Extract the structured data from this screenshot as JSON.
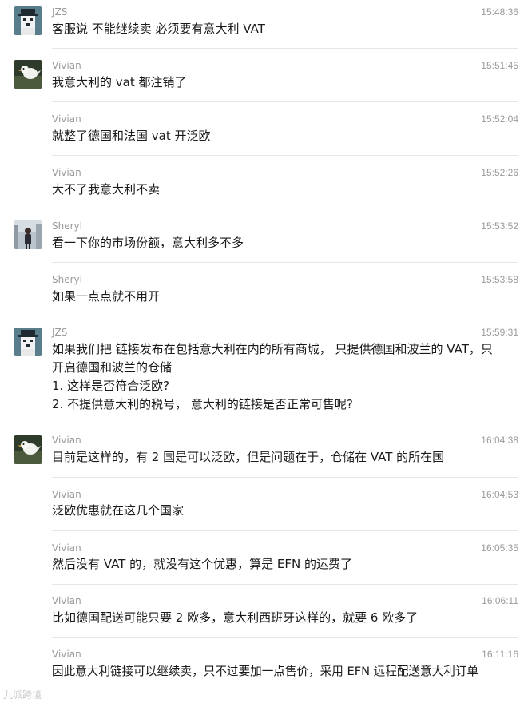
{
  "messages": [
    {
      "sender": "JZS",
      "time": "15:48:36",
      "avatar": "jzs-pixel-avatar",
      "lines": [
        "客服说 不能继续卖  必须要有意大利 VAT"
      ]
    },
    {
      "sender": "Vivian",
      "time": "15:51:45",
      "avatar": "vivian-bird-avatar",
      "lines": [
        "我意大利的 vat 都注销了"
      ]
    },
    {
      "sender": "Vivian",
      "time": "15:52:04",
      "avatar": "",
      "lines": [
        "就整了德国和法国 vat 开泛欧"
      ]
    },
    {
      "sender": "Vivian",
      "time": "15:52:26",
      "avatar": "",
      "lines": [
        "大不了我意大利不卖"
      ]
    },
    {
      "sender": "Sheryl",
      "time": "15:53:52",
      "avatar": "sheryl-photo-avatar",
      "lines": [
        "看一下你的市场份额，意大利多不多"
      ]
    },
    {
      "sender": "Sheryl",
      "time": "15:53:58",
      "avatar": "",
      "lines": [
        "如果一点点就不用开"
      ]
    },
    {
      "sender": "JZS",
      "time": "15:59:31",
      "avatar": "jzs-pixel-avatar",
      "lines": [
        "如果我们把 链接发布在包括意大利在内的所有商城， 只提供德国和波兰的 VAT，只",
        "开启德国和波兰的仓储",
        "1. 这样是否符合泛欧?",
        "2. 不提供意大利的税号， 意大利的链接是否正常可售呢?"
      ]
    },
    {
      "sender": "Vivian",
      "time": "16:04:38",
      "avatar": "vivian-bird-avatar",
      "lines": [
        "目前是这样的，有 2 国是可以泛欧，但是问题在于，仓储在 VAT 的所在国"
      ]
    },
    {
      "sender": "Vivian",
      "time": "16:04:53",
      "avatar": "",
      "lines": [
        "泛欧优惠就在这几个国家"
      ]
    },
    {
      "sender": "Vivian",
      "time": "16:05:35",
      "avatar": "",
      "lines": [
        "然后没有 VAT 的，就没有这个优惠，算是 EFN 的运费了"
      ]
    },
    {
      "sender": "Vivian",
      "time": "16:06:11",
      "avatar": "",
      "lines": [
        "比如德国配送可能只要 2 欧多，意大利西班牙这样的，就要 6 欧多了"
      ]
    },
    {
      "sender": "Vivian",
      "time": "16:11:16",
      "avatar": "",
      "lines": [
        "因此意大利链接可以继续卖，只不过要加一点售价，采用 EFN 远程配送意大利订单"
      ]
    }
  ],
  "watermark": "九派跨境",
  "colors": {
    "meta": "#9a9a9a",
    "text": "#1a1a1a",
    "divider": "#e6e6e6"
  }
}
